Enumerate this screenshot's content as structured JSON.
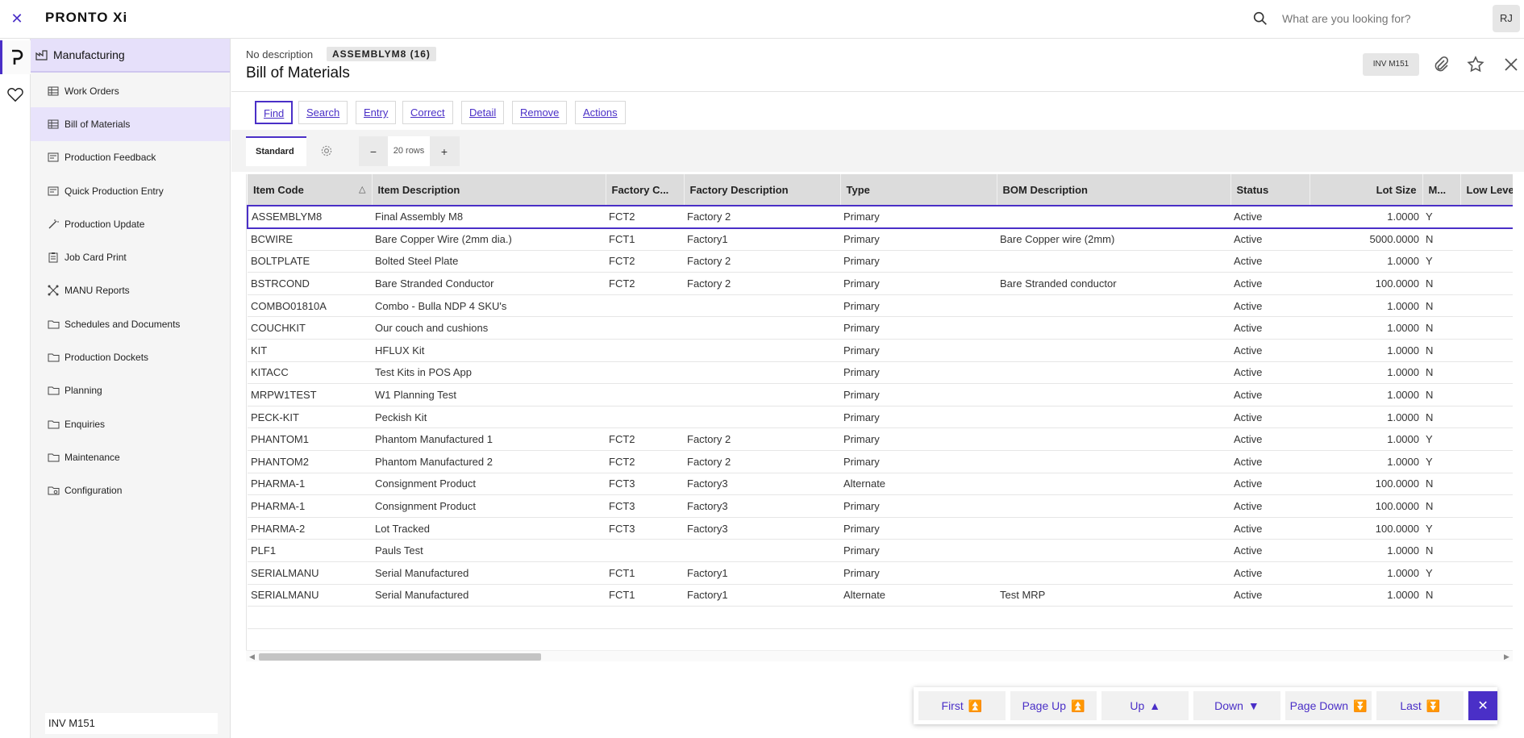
{
  "topbar": {
    "logo": "PRONTO Xi",
    "search_placeholder": "What are you looking for?",
    "avatar": "RJ"
  },
  "sidebar": {
    "module": "Manufacturing",
    "items": [
      {
        "label": "Work Orders",
        "icon": "table-icon"
      },
      {
        "label": "Bill of Materials",
        "icon": "table-icon"
      },
      {
        "label": "Production Feedback",
        "icon": "form-icon"
      },
      {
        "label": "Quick Production Entry",
        "icon": "form-icon"
      },
      {
        "label": "Production Update",
        "icon": "wand-icon"
      },
      {
        "label": "Job Card Print",
        "icon": "clipboard-icon"
      },
      {
        "label": "MANU Reports",
        "icon": "report-icon"
      },
      {
        "label": "Schedules and Documents",
        "icon": "folder-icon"
      },
      {
        "label": "Production Dockets",
        "icon": "folder-icon"
      },
      {
        "label": "Planning",
        "icon": "folder-icon"
      },
      {
        "label": "Enquiries",
        "icon": "folder-icon"
      },
      {
        "label": "Maintenance",
        "icon": "folder-icon"
      },
      {
        "label": "Configuration",
        "icon": "folder-gear-icon"
      }
    ],
    "footer": "INV M151"
  },
  "header": {
    "description": "No description",
    "code": "ASSEMBLYM8 (16)",
    "title": "Bill of Materials",
    "badge": "INV M151"
  },
  "toolbar": {
    "find": "Find",
    "search": "Search",
    "entry": "Entry",
    "correct": "Correct",
    "detail": "Detail",
    "remove": "Remove",
    "actions": "Actions"
  },
  "view": {
    "tab": "Standard",
    "rows": "20 rows"
  },
  "table": {
    "columns": [
      "Item Code",
      "Item Description",
      "Factory C...",
      "Factory Description",
      "Type",
      "BOM Description",
      "Status",
      "Lot Size",
      "M...",
      "Low Level"
    ],
    "rows": [
      [
        "ASSEMBLYM8",
        "Final Assembly M8",
        "FCT2",
        "Factory 2",
        "Primary",
        "",
        "Active",
        "1.0000",
        "Y",
        ""
      ],
      [
        "BCWIRE",
        "Bare Copper Wire (2mm dia.)",
        "FCT1",
        "Factory1",
        "Primary",
        "Bare Copper wire (2mm)",
        "Active",
        "5000.0000",
        "N",
        ""
      ],
      [
        "BOLTPLATE",
        "Bolted Steel Plate",
        "FCT2",
        "Factory 2",
        "Primary",
        "",
        "Active",
        "1.0000",
        "Y",
        ""
      ],
      [
        "BSTRCOND",
        "Bare Stranded Conductor",
        "FCT2",
        "Factory 2",
        "Primary",
        "Bare Stranded conductor",
        "Active",
        "100.0000",
        "N",
        ""
      ],
      [
        "COMBO01810A",
        "Combo - Bulla NDP 4 SKU's",
        "",
        "",
        "Primary",
        "",
        "Active",
        "1.0000",
        "N",
        ""
      ],
      [
        "COUCHKIT",
        "Our couch and cushions",
        "",
        "",
        "Primary",
        "",
        "Active",
        "1.0000",
        "N",
        ""
      ],
      [
        "KIT",
        "HFLUX Kit",
        "",
        "",
        "Primary",
        "",
        "Active",
        "1.0000",
        "N",
        ""
      ],
      [
        "KITACC",
        "Test Kits in POS App",
        "",
        "",
        "Primary",
        "",
        "Active",
        "1.0000",
        "N",
        ""
      ],
      [
        "MRPW1TEST",
        "W1 Planning Test",
        "",
        "",
        "Primary",
        "",
        "Active",
        "1.0000",
        "N",
        ""
      ],
      [
        "PECK-KIT",
        "Peckish Kit",
        "",
        "",
        "Primary",
        "",
        "Active",
        "1.0000",
        "N",
        ""
      ],
      [
        "PHANTOM1",
        "Phantom Manufactured 1",
        "FCT2",
        "Factory 2",
        "Primary",
        "",
        "Active",
        "1.0000",
        "Y",
        ""
      ],
      [
        "PHANTOM2",
        "Phantom Manufactured 2",
        "FCT2",
        "Factory 2",
        "Primary",
        "",
        "Active",
        "1.0000",
        "Y",
        ""
      ],
      [
        "PHARMA-1",
        "Consignment Product",
        "FCT3",
        "Factory3",
        "Alternate",
        "",
        "Active",
        "100.0000",
        "N",
        ""
      ],
      [
        "PHARMA-1",
        "Consignment Product",
        "FCT3",
        "Factory3",
        "Primary",
        "",
        "Active",
        "100.0000",
        "N",
        ""
      ],
      [
        "PHARMA-2",
        "Lot Tracked",
        "FCT3",
        "Factory3",
        "Primary",
        "",
        "Active",
        "100.0000",
        "Y",
        ""
      ],
      [
        "PLF1",
        "Pauls Test",
        "",
        "",
        "Primary",
        "",
        "Active",
        "1.0000",
        "N",
        ""
      ],
      [
        "SERIALMANU",
        "Serial Manufactured",
        "FCT1",
        "Factory1",
        "Primary",
        "",
        "Active",
        "1.0000",
        "Y",
        ""
      ],
      [
        "SERIALMANU",
        "Serial Manufactured",
        "FCT1",
        "Factory1",
        "Alternate",
        "Test MRP",
        "Active",
        "1.0000",
        "N",
        ""
      ],
      [
        "",
        "",
        "",
        "",
        "",
        "",
        "",
        "",
        "",
        ""
      ],
      [
        "",
        "",
        "",
        "",
        "",
        "",
        "",
        "",
        "",
        ""
      ]
    ]
  },
  "pager": {
    "first": "First",
    "page_up": "Page Up",
    "up": "Up",
    "down": "Down",
    "page_down": "Page Down",
    "last": "Last"
  },
  "colors": {
    "accent": "#4a2fc7",
    "selected_bg": "#e8e3fb"
  }
}
